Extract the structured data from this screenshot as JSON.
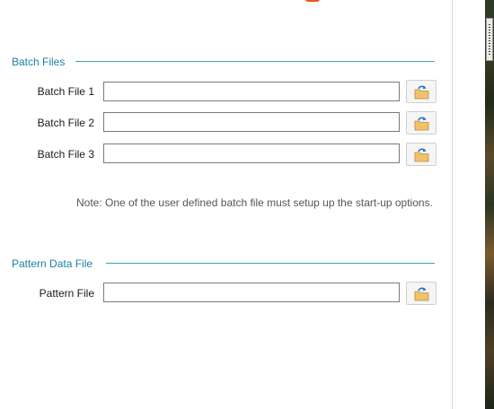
{
  "batch_files": {
    "title": "Batch Files",
    "rows": [
      {
        "label": "Batch File 1",
        "value": ""
      },
      {
        "label": "Batch File 2",
        "value": ""
      },
      {
        "label": "Batch File 3",
        "value": ""
      }
    ],
    "note": "Note: One of the user defined batch file must setup up the start-up options."
  },
  "pattern_data": {
    "title": "Pattern Data File",
    "rows": [
      {
        "label": "Pattern File",
        "value": ""
      }
    ]
  },
  "icons": {
    "browse": "folder-browse-icon"
  },
  "colors": {
    "section_title": "#1a7fa8",
    "section_rule": "#2fa9b8",
    "folder": "#f0c36a",
    "arrow": "#1f6fc1"
  }
}
